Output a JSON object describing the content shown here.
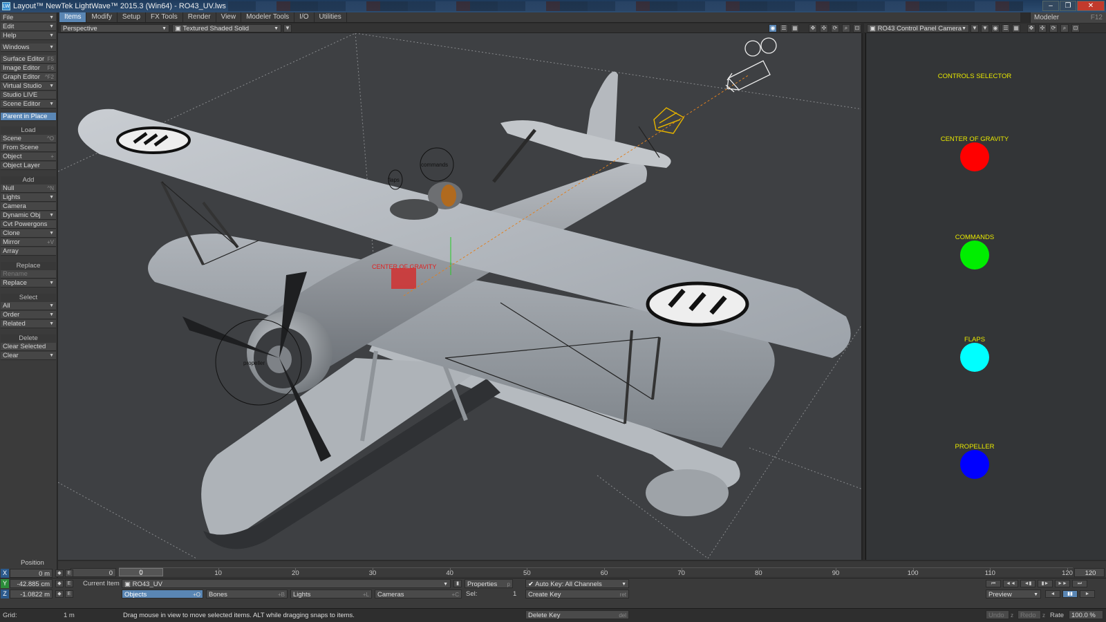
{
  "window": {
    "title": "Layout™ NewTek LightWave™ 2015.3 (Win64) - RO43_UV.lws",
    "app_icon": "lw-app-icon",
    "buttons": [
      "–",
      "❐",
      "✕"
    ]
  },
  "menu_tabs": [
    "Items",
    "Modify",
    "Setup",
    "FX Tools",
    "Render",
    "View",
    "Modeler Tools",
    "I/O",
    "Utilities"
  ],
  "active_tab": "Items",
  "modeler_button": {
    "label": "Modeler",
    "shortcut": "F12"
  },
  "toolbar": {
    "file": "File",
    "edit": "Edit",
    "help": "Help",
    "windows": "Windows",
    "surface_editor": {
      "label": "Surface Editor",
      "shortcut": "F5"
    },
    "image_editor": {
      "label": "Image Editor",
      "shortcut": "F6"
    },
    "graph_editor": {
      "label": "Graph Editor",
      "shortcut": "^F2"
    },
    "virtual_studio": "Virtual Studio",
    "studio_live": "Studio LIVE",
    "scene_editor": "Scene Editor",
    "parent_in_place": "Parent in Place",
    "load_head": "Load",
    "scene": {
      "label": "Scene",
      "shortcut": "^O"
    },
    "from_scene": "From Scene",
    "object": {
      "label": "Object",
      "shortcut": "+"
    },
    "object_layer": "Object Layer",
    "add_head": "Add",
    "null": {
      "label": "Null",
      "shortcut": "^N"
    },
    "lights": "Lights",
    "camera": "Camera",
    "dynamic_obj": "Dynamic Obj",
    "cvt_powergons": "Cvt Powergons",
    "clone": "Clone",
    "mirror": {
      "label": "Mirror",
      "shortcut": "+V"
    },
    "array": "Array",
    "replace_head": "Replace",
    "rename": "Rename",
    "replace": "Replace",
    "select_head": "Select",
    "all": "All",
    "order": "Order",
    "related": "Related",
    "delete_head": "Delete",
    "clear_selected": "Clear Selected",
    "clear": "Clear"
  },
  "viewport": {
    "view_mode": "Perspective",
    "render_mode": "Textured Shaded Solid",
    "labels": {
      "flaps": "flaps",
      "commands": "commands",
      "propeller": "propeller",
      "cog": "CENTER OF GRAVITY"
    }
  },
  "right_viewport": {
    "camera": "RO43 Control Panel Camera",
    "title": "CONTROLS SELECTOR",
    "controls": [
      {
        "label": "CENTER OF GRAVITY",
        "color": "#ff0000"
      },
      {
        "label": "COMMANDS",
        "color": "#00ee00"
      },
      {
        "label": "FLAPS",
        "color": "#00ffff"
      },
      {
        "label": "PROPELLER",
        "color": "#0000ff"
      }
    ]
  },
  "timeline": {
    "ticks": [
      "0",
      "10",
      "20",
      "30",
      "40",
      "50",
      "60",
      "70",
      "80",
      "90",
      "100",
      "110",
      "120"
    ],
    "start": "0",
    "current": "0",
    "end": "120",
    "min": 0,
    "max": 120
  },
  "position": {
    "label": "Position",
    "x_axis": "X",
    "y_axis": "Y",
    "z_axis": "Z",
    "x": "0 m",
    "y": "-42.885 cm",
    "z": "-1.0822 m",
    "e_label": "E",
    "grid_label": "Grid:",
    "grid": "1 m"
  },
  "current_item": {
    "label": "Current Item",
    "value": "RO43_UV",
    "properties": {
      "label": "Properties",
      "shortcut": "p"
    },
    "sel_label": "Sel:",
    "sel": "1"
  },
  "item_types": [
    {
      "label": "Objects",
      "shortcut": "+O",
      "active": true
    },
    {
      "label": "Bones",
      "shortcut": "+B",
      "active": false
    },
    {
      "label": "Lights",
      "shortcut": "+L",
      "active": false
    },
    {
      "label": "Cameras",
      "shortcut": "+C",
      "active": false
    }
  ],
  "keys": {
    "auto_key": "Auto Key: All Channels",
    "create_key": {
      "label": "Create Key",
      "shortcut": "ret"
    },
    "delete_key": {
      "label": "Delete Key",
      "shortcut": "del"
    }
  },
  "playback": {
    "preview": "Preview",
    "undo": "Undo",
    "undo_key": "z",
    "redo": "Redo",
    "redo_key": "z",
    "rate_label": "Rate",
    "rate": "100.0 %",
    "top_row": [
      "⏮",
      "◄◄",
      "◄▮",
      "▮►",
      "►►",
      "⏭"
    ],
    "bottom_row": [
      "◄",
      "▮▮",
      "►"
    ]
  },
  "status": "Drag mouse in view to move selected items. ALT while dragging snaps to items.",
  "colors": {
    "accent": "#5a86b4",
    "label_yellow": "#e8e800"
  }
}
